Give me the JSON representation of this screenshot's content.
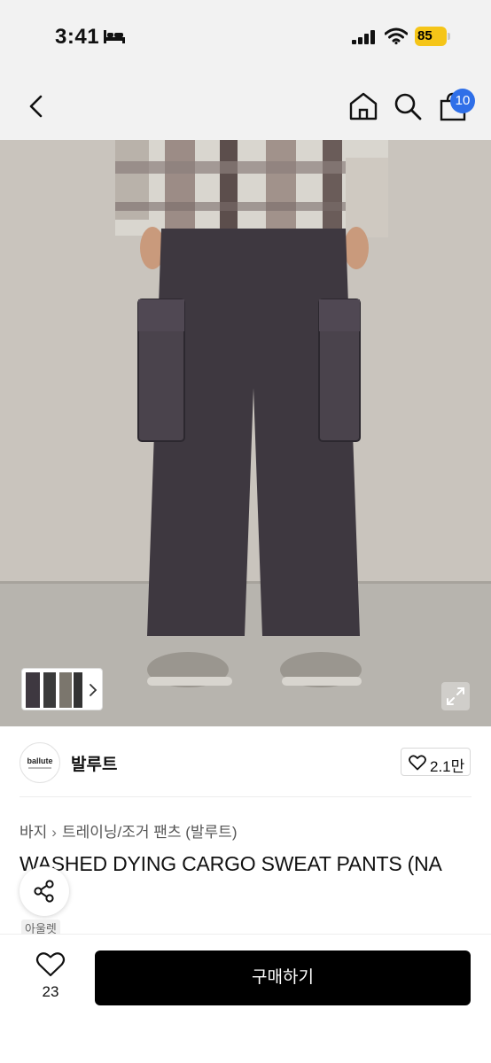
{
  "status_bar": {
    "time": "3:41",
    "battery": "85"
  },
  "navbar": {
    "cart_count": "10",
    "icons": [
      "back-chevron-icon",
      "home-icon",
      "search-icon",
      "cart-icon"
    ]
  },
  "product": {
    "image_nav_icon": "chevron-right-icon",
    "expand_icon": "expand-icon",
    "brand": {
      "logo_text": "ballute",
      "name": "발루트",
      "likes": "2.1만"
    },
    "breadcrumb": [
      "바지",
      "트레이닝/조거 팬츠 (발루트)"
    ],
    "title": "WASHED DYING CARGO SWEAT PANTS (NA",
    "tag": "아울렛"
  },
  "bottom_bar": {
    "wish_count": "23",
    "buy_label": "구매하기"
  },
  "colors": {
    "accent": "#2f6fe8",
    "battery": "#f5c518",
    "buy_button": "#000000"
  }
}
